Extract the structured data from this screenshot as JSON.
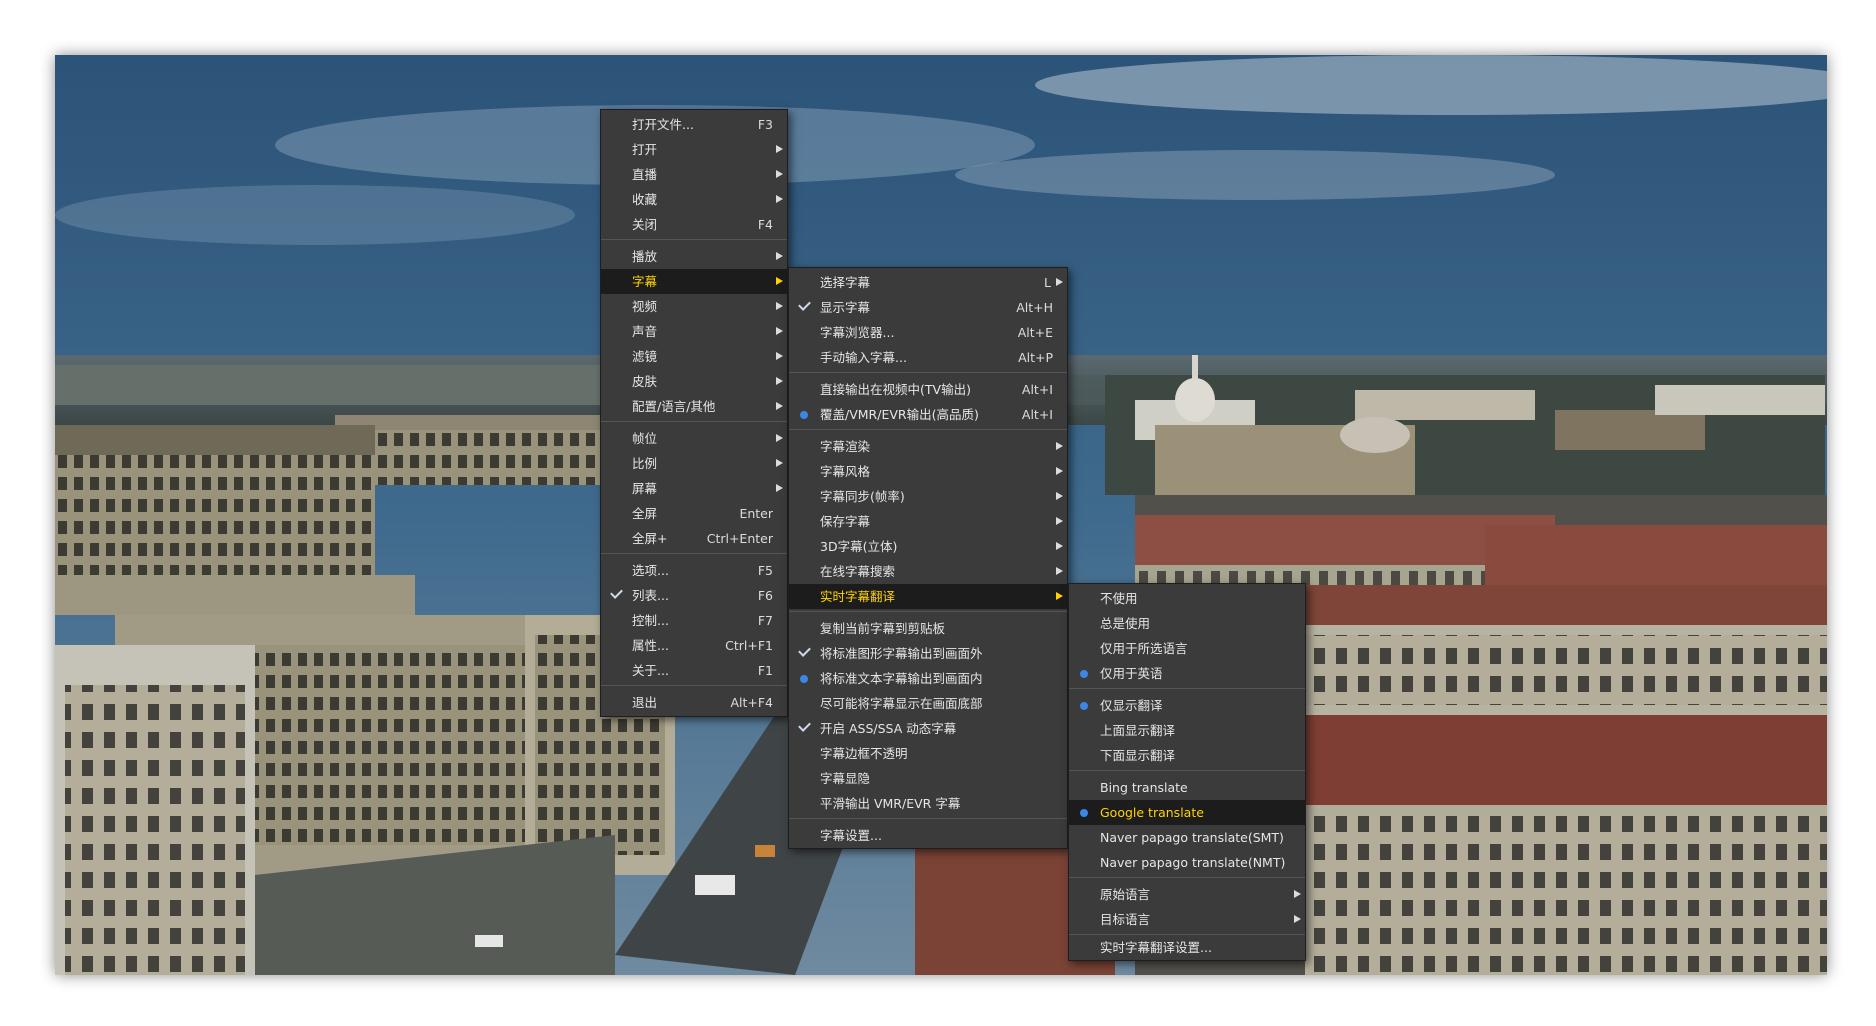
{
  "colors": {
    "menu_bg": "#3b3b3b",
    "menu_border": "#1e1e1e",
    "separator": "#555555",
    "text": "#e6e6e6",
    "active_bg": "#1c1c1c",
    "active_text": "#ffd200",
    "radio_dot": "#3c86e6"
  },
  "main_menu": {
    "items": [
      {
        "label": "打开文件...",
        "shortcut": "F3"
      },
      {
        "label": "打开",
        "arrow": true
      },
      {
        "label": "直播",
        "arrow": true
      },
      {
        "label": "收藏",
        "arrow": true
      },
      {
        "label": "关闭",
        "shortcut": "F4"
      },
      {
        "separator": true
      },
      {
        "label": "播放",
        "arrow": true
      },
      {
        "label": "字幕",
        "arrow": true,
        "active": true
      },
      {
        "label": "视频",
        "arrow": true
      },
      {
        "label": "声音",
        "arrow": true
      },
      {
        "label": "滤镜",
        "arrow": true
      },
      {
        "label": "皮肤",
        "arrow": true
      },
      {
        "label": "配置/语言/其他",
        "arrow": true
      },
      {
        "separator": true
      },
      {
        "label": "帧位",
        "arrow": true
      },
      {
        "label": "比例",
        "arrow": true
      },
      {
        "label": "屏幕",
        "arrow": true
      },
      {
        "label": "全屏",
        "shortcut": "Enter"
      },
      {
        "label": "全屏+",
        "shortcut": "Ctrl+Enter"
      },
      {
        "separator": true
      },
      {
        "label": "选项...",
        "shortcut": "F5"
      },
      {
        "label": "列表...",
        "shortcut": "F6",
        "checked": true
      },
      {
        "label": "控制...",
        "shortcut": "F7"
      },
      {
        "label": "属性...",
        "shortcut": "Ctrl+F1"
      },
      {
        "label": "关于...",
        "shortcut": "F1"
      },
      {
        "separator": true
      },
      {
        "label": "退出",
        "shortcut": "Alt+F4"
      }
    ]
  },
  "subtitle_menu": {
    "items": [
      {
        "label": "选择字幕",
        "shortcut": "L",
        "arrow": true
      },
      {
        "label": "显示字幕",
        "shortcut": "Alt+H",
        "checked": true
      },
      {
        "label": "字幕浏览器...",
        "shortcut": "Alt+E"
      },
      {
        "label": "手动输入字幕...",
        "shortcut": "Alt+P"
      },
      {
        "separator": true
      },
      {
        "label": "直接输出在视频中(TV输出)",
        "shortcut": "Alt+I"
      },
      {
        "label": "覆盖/VMR/EVR输出(高品质)",
        "shortcut": "Alt+I",
        "radio": true
      },
      {
        "separator": true
      },
      {
        "label": "字幕渲染",
        "arrow": true
      },
      {
        "label": "字幕风格",
        "arrow": true
      },
      {
        "label": "字幕同步(帧率)",
        "arrow": true
      },
      {
        "label": "保存字幕",
        "arrow": true
      },
      {
        "label": "3D字幕(立体)",
        "arrow": true
      },
      {
        "label": "在线字幕搜索",
        "arrow": true
      },
      {
        "label": "实时字幕翻译",
        "arrow": true,
        "active": true
      },
      {
        "separator": true
      },
      {
        "label": "复制当前字幕到剪贴板"
      },
      {
        "label": "将标准图形字幕输出到画面外",
        "checked": true
      },
      {
        "label": "将标准文本字幕输出到画面内",
        "radio": true
      },
      {
        "label": "尽可能将字幕显示在画面底部"
      },
      {
        "label": "开启 ASS/SSA 动态字幕",
        "checked": true
      },
      {
        "label": "字幕边框不透明"
      },
      {
        "label": "字幕显隐"
      },
      {
        "label": "平滑输出 VMR/EVR 字幕"
      },
      {
        "separator": true
      },
      {
        "label": "字幕设置..."
      }
    ]
  },
  "translate_menu": {
    "items": [
      {
        "label": "不使用"
      },
      {
        "label": "总是使用"
      },
      {
        "label": "仅用于所选语言"
      },
      {
        "label": "仅用于英语",
        "radio": true
      },
      {
        "separator": true
      },
      {
        "label": "仅显示翻译",
        "radio": true
      },
      {
        "label": "上面显示翻译"
      },
      {
        "label": "下面显示翻译"
      },
      {
        "separator": true
      },
      {
        "label": "Bing translate"
      },
      {
        "label": "Google translate",
        "radio": true,
        "active": true
      },
      {
        "label": "Naver papago translate(SMT)"
      },
      {
        "label": "Naver papago translate(NMT)"
      },
      {
        "separator": true
      },
      {
        "label": "原始语言",
        "arrow": true
      },
      {
        "label": "目标语言",
        "arrow": true
      },
      {
        "separator": true
      },
      {
        "label": "实时字幕翻译设置..."
      }
    ]
  }
}
